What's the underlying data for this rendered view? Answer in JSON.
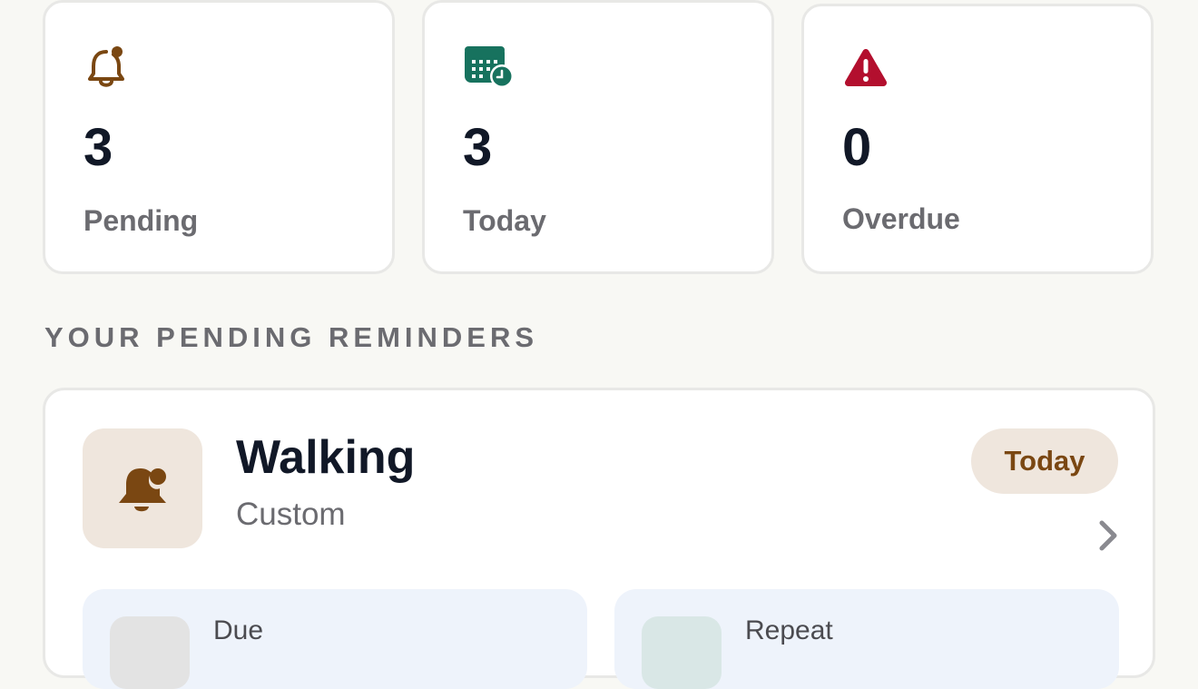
{
  "stats": [
    {
      "icon": "bell-icon",
      "value": "3",
      "label": "Pending",
      "color": "#7a4712"
    },
    {
      "icon": "calendar-clock-icon",
      "value": "3",
      "label": "Today",
      "color": "#17725e"
    },
    {
      "icon": "warning-icon",
      "value": "0",
      "label": "Overdue",
      "color": "#b30f2e"
    }
  ],
  "section": {
    "title": "YOUR PENDING REMINDERS"
  },
  "reminder": {
    "icon": "bell-icon",
    "title": "Walking",
    "subtitle": "Custom",
    "badge": "Today",
    "chevron": "chevron-right-icon",
    "details": [
      {
        "label": "Due",
        "background": "#eef3fb",
        "icon_bg": "#e3e3e3"
      },
      {
        "label": "Repeat",
        "background": "#eef3fb",
        "icon_bg": "#d9e7e6"
      }
    ]
  },
  "colors": {
    "background": "#f8f8f4",
    "accent_brown": "#7a4712",
    "accent_teal": "#17725e",
    "accent_red": "#b30f2e",
    "badge_bg": "#efe6dd"
  }
}
